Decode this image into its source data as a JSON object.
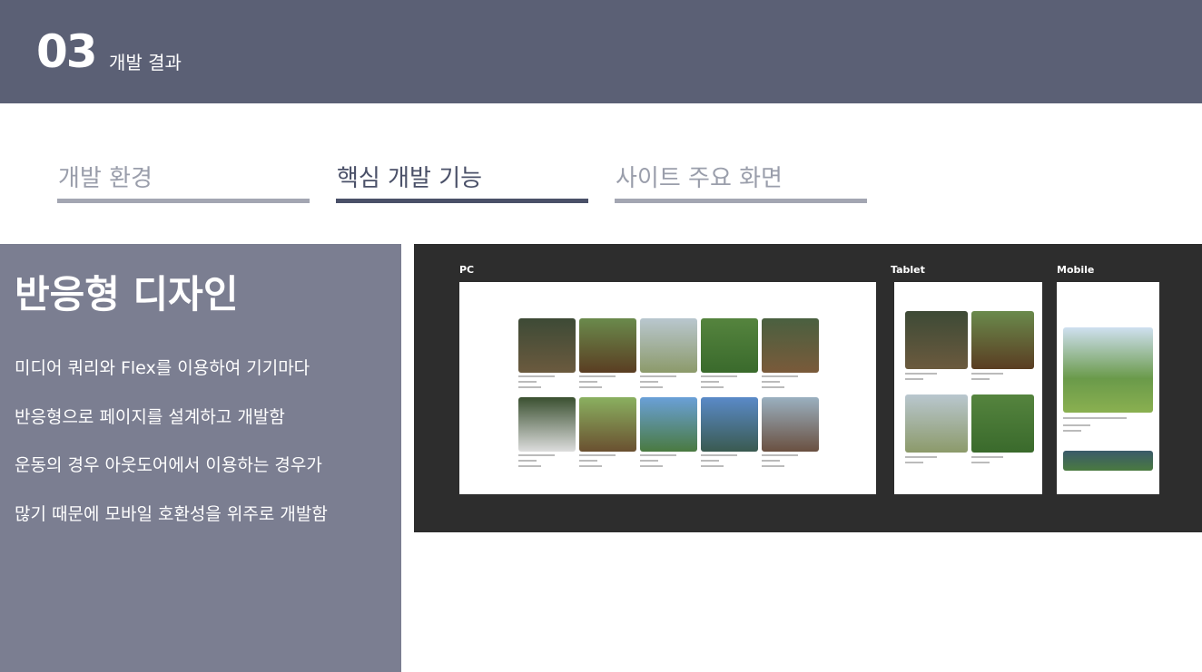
{
  "header": {
    "number": "03",
    "section": "개발 결과"
  },
  "tabs": [
    {
      "label": "개발 환경",
      "active": false
    },
    {
      "label": "핵심 개발 기능",
      "active": true
    },
    {
      "label": "사이트 주요 화면",
      "active": false
    }
  ],
  "panel": {
    "title": "반응형 디자인",
    "lines": [
      "미디어 쿼리와 Flex를 이용하여  기기마다",
      "반응형으로 페이지를 설계하고 개발함",
      "운동의 경우 아웃도어에서 이용하는 경우가",
      "많기 때문에 모바일 호환성을 위주로 개발함"
    ]
  },
  "showcase": {
    "pc_label": "PC",
    "tablet_label": "Tablet",
    "mobile_label": "Mobile"
  }
}
